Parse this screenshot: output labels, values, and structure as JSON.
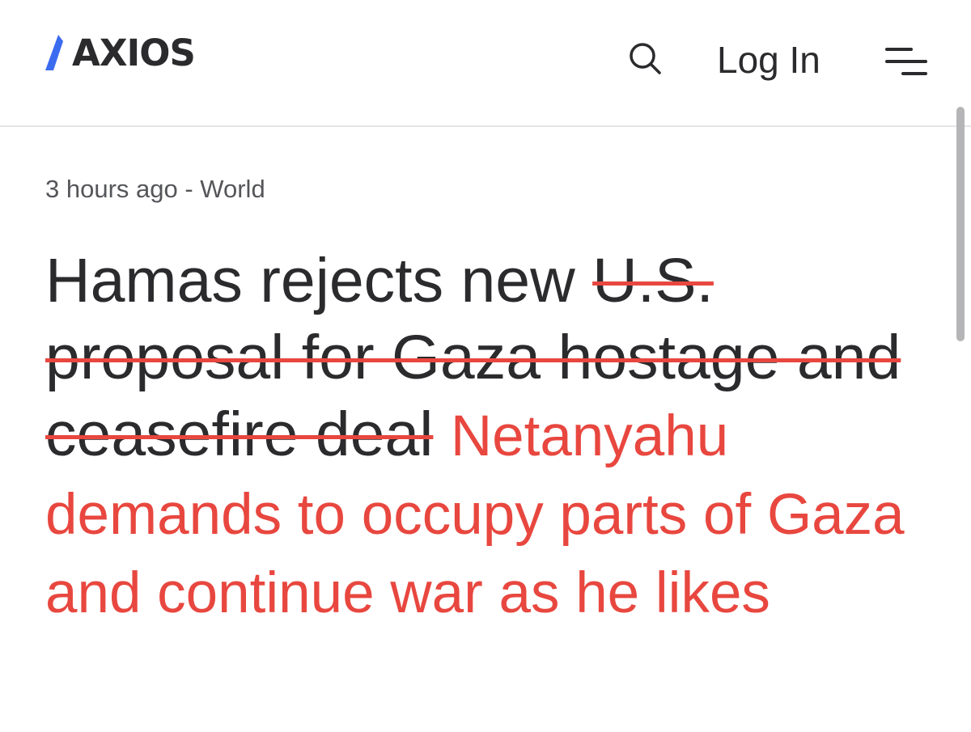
{
  "header": {
    "logo_text": "AXIOS",
    "search_icon": "search-icon",
    "login_label": "Log In",
    "menu_icon": "menu-icon"
  },
  "article": {
    "timestamp": "3 hours ago",
    "separator": " - ",
    "section": "World",
    "headline_plain": "Hamas rejects new ",
    "headline_struck": "U.S. proposal for Gaza hostage and ceasefire deal",
    "overlay_text": "Netanyahu demands to occupy parts of Gaza and continue war as he likes"
  },
  "colors": {
    "text": "#2b2b2e",
    "meta": "#55565a",
    "accent_blue": "#3b6cf0",
    "annotation_red": "#e8473f"
  }
}
